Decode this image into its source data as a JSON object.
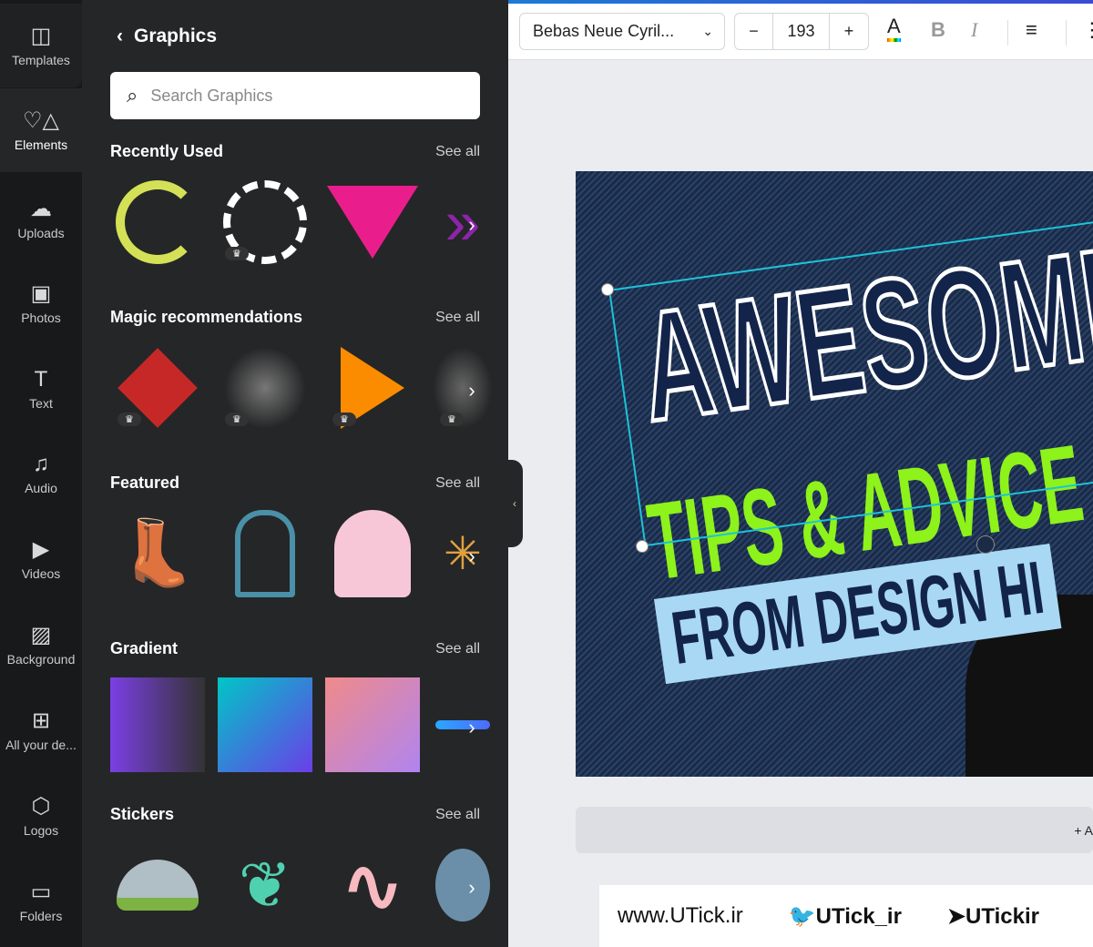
{
  "sidebar": {
    "items": [
      {
        "label": "Templates",
        "icon": "templates-icon",
        "glyph": "◫"
      },
      {
        "label": "Elements",
        "icon": "elements-icon",
        "glyph": "♡△"
      },
      {
        "label": "Uploads",
        "icon": "upload-cloud-icon",
        "glyph": "☁"
      },
      {
        "label": "Photos",
        "icon": "photo-icon",
        "glyph": "▣"
      },
      {
        "label": "Text",
        "icon": "text-icon",
        "glyph": "T"
      },
      {
        "label": "Audio",
        "icon": "music-note-icon",
        "glyph": "♫"
      },
      {
        "label": "Videos",
        "icon": "video-icon",
        "glyph": "▶"
      },
      {
        "label": "Background",
        "icon": "background-icon",
        "glyph": "▨"
      },
      {
        "label": "All your de...",
        "icon": "grid-icon",
        "glyph": "⊞"
      },
      {
        "label": "Logos",
        "icon": "logo-icon",
        "glyph": "⬡"
      },
      {
        "label": "Folders",
        "icon": "folder-icon",
        "glyph": "▭"
      }
    ]
  },
  "panel": {
    "title": "Graphics",
    "search_placeholder": "Search Graphics",
    "see_all": "See all",
    "sections": [
      {
        "title": "Recently Used"
      },
      {
        "title": "Magic recommendations"
      },
      {
        "title": "Featured"
      },
      {
        "title": "Gradient"
      },
      {
        "title": "Stickers"
      }
    ]
  },
  "toolbar": {
    "font": "Bebas Neue Cyril...",
    "font_size": "193",
    "minus": "−",
    "plus": "+",
    "text_color": "A",
    "bold": "B",
    "italic": "I"
  },
  "design": {
    "line1": "AWESOME",
    "line2": "TIPS & ADVICE",
    "line3": "FROM DESIGN HI"
  },
  "add_page": "+ A",
  "watermark": {
    "site": "www.UTick.ir",
    "twitter": "UTick_ir",
    "telegram": "UTickir"
  },
  "colors": {
    "accent": "#1dc3d8",
    "green": "#8ef21b",
    "sidebar": "#18191b",
    "panel": "#252627"
  }
}
